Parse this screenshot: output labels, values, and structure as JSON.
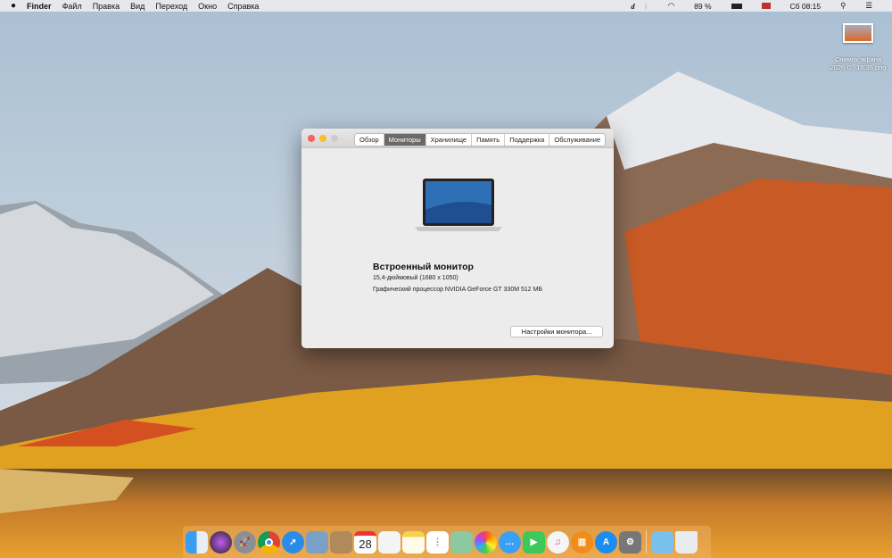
{
  "menubar": {
    "apple": "",
    "app": "Finder",
    "items": [
      "Файл",
      "Правка",
      "Вид",
      "Переход",
      "Окно",
      "Справка"
    ],
    "battery": "89 %",
    "clock": "Сб 08:15"
  },
  "desktop_icon": {
    "name1": "Снимок экрана",
    "name2": "2026-0...15.36.png"
  },
  "window": {
    "tabs": [
      "Обзор",
      "Мониторы",
      "Хранилище",
      "Память",
      "Поддержка",
      "Обслуживание"
    ],
    "active_tab": 1,
    "display_name": "Встроенный монитор",
    "size": "15,4-дюймовый (1680 x 1050)",
    "gpu": "Графический процессор NVIDIA GeForce GT 330M 512 МБ",
    "button": "Настройки монитора..."
  },
  "dock": {
    "calendar_day": "28",
    "apps": [
      "finder",
      "siri",
      "launchpad",
      "chrome",
      "safari",
      "preview",
      "contacts",
      "calendar",
      "textedit",
      "notes",
      "reminders",
      "maps",
      "photos",
      "messages",
      "facetime",
      "itunes",
      "ibooks",
      "app-store",
      "system-preferences"
    ],
    "extras": [
      "downloads",
      "trash"
    ]
  }
}
